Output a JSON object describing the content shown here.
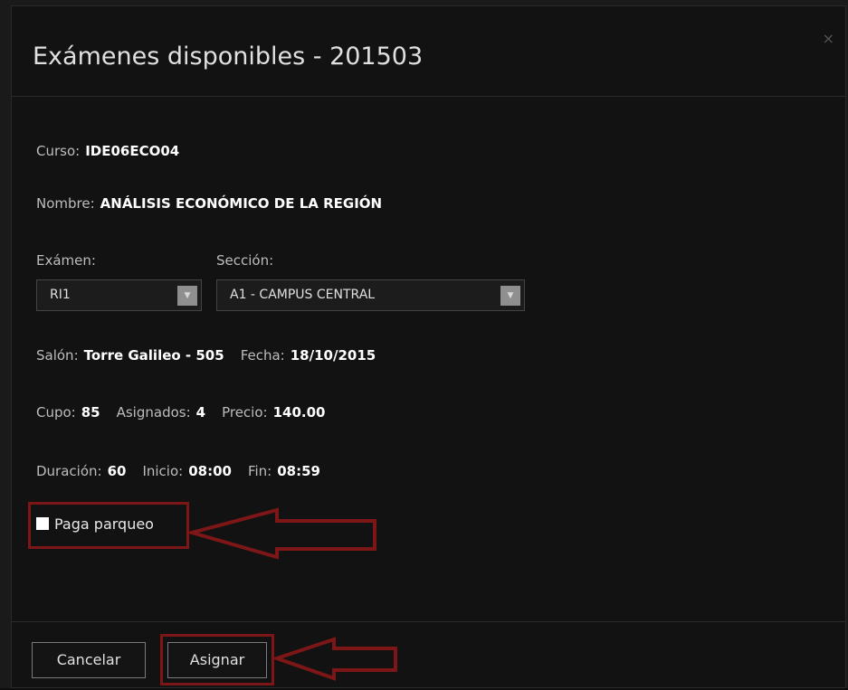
{
  "modal": {
    "title": "Exámenes disponibles - 201503",
    "close_icon": "×"
  },
  "course": {
    "curso_label": "Curso:",
    "curso_value": "IDE06ECO04",
    "nombre_label": "Nombre:",
    "nombre_value": "ANÁLISIS ECONÓMICO DE LA REGIÓN"
  },
  "selectors": {
    "examen_label": "Exámen:",
    "examen_value": "RI1",
    "seccion_label": "Sección:",
    "seccion_value": "A1 - CAMPUS CENTRAL"
  },
  "details": {
    "salon_label": "Salón:",
    "salon_value": "Torre Galileo - 505",
    "fecha_label": "Fecha:",
    "fecha_value": "18/10/2015",
    "cupo_label": "Cupo:",
    "cupo_value": "85",
    "asignados_label": "Asignados:",
    "asignados_value": "4",
    "precio_label": "Precio:",
    "precio_value": "140.00",
    "duracion_label": "Duración:",
    "duracion_value": "60",
    "inicio_label": "Inicio:",
    "inicio_value": "08:00",
    "fin_label": "Fin:",
    "fin_value": "08:59"
  },
  "parking": {
    "label": "Paga parqueo",
    "checked": false
  },
  "footer": {
    "cancel_label": "Cancelar",
    "assign_label": "Asignar"
  },
  "icons": {
    "select_arrow": "chevron-down-icon",
    "annotation": "arrow-left-icon"
  },
  "colors": {
    "background": "#121212",
    "annotation_red": "#7d1616",
    "text": "#bdbdbd",
    "value_text": "#ffffff"
  }
}
